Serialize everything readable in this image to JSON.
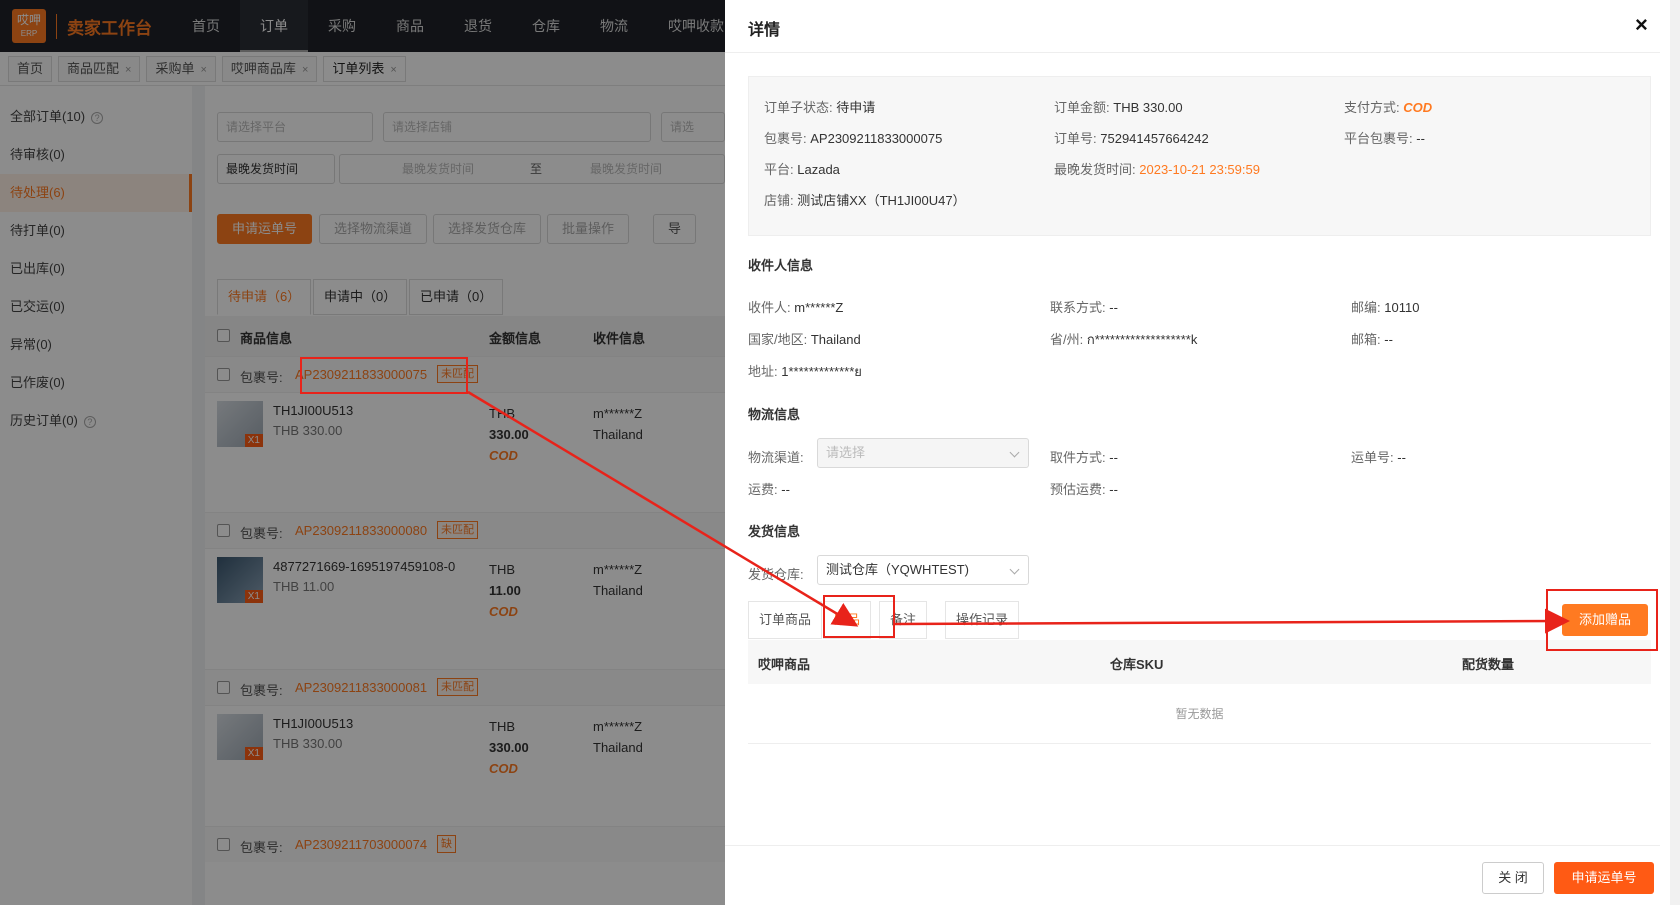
{
  "app": {
    "logo_top": "哎呷",
    "logo_bottom": "ERP",
    "brand": "卖家工作台"
  },
  "topnav": [
    "首页",
    "订单",
    "采购",
    "商品",
    "退货",
    "仓库",
    "物流",
    "哎呷收款"
  ],
  "page_tabs": [
    {
      "label": "首页"
    },
    {
      "label": "商品匹配"
    },
    {
      "label": "采购单"
    },
    {
      "label": "哎呷商品库"
    },
    {
      "label": "订单列表"
    }
  ],
  "sidebar": [
    {
      "label": "全部订单(10)"
    },
    {
      "label": "待审核(0)"
    },
    {
      "label": "待处理(6)"
    },
    {
      "label": "待打单(0)"
    },
    {
      "label": "已出库(0)"
    },
    {
      "label": "已交运(0)"
    },
    {
      "label": "异常(0)"
    },
    {
      "label": "已作废(0)"
    },
    {
      "label": "历史订单(0)"
    }
  ],
  "filters": {
    "platform_placeholder": "请选择平台",
    "shop_placeholder": "请选择店铺",
    "more_placeholder": "请选",
    "time_type": "最晚发货时间",
    "time_start": "最晚发货时间",
    "time_sep": "至",
    "time_end": "最晚发货时间"
  },
  "actions": [
    "申请运单号",
    "选择物流渠道",
    "选择发货仓库",
    "批量操作",
    "导"
  ],
  "status_tabs": [
    "待申请（6）",
    "申请中（0）",
    "已申请（0）"
  ],
  "table_head": {
    "product": "商品信息",
    "amount": "金额信息",
    "receiver": "收件信息"
  },
  "orders": [
    {
      "pkg_label": "包裹号:",
      "pkg_no": "AP2309211833000075",
      "badge": "未匹配",
      "title": "TH1JI00U513",
      "price": "THB 330.00",
      "qty": "X1",
      "cur": "THB",
      "amount": "330.00",
      "pay": "COD",
      "recv_name": "m******Z",
      "recv_country": "Thailand"
    },
    {
      "pkg_label": "包裹号:",
      "pkg_no": "AP2309211833000080",
      "badge": "未匹配",
      "title": "4877271669-1695197459108-0",
      "price": "THB 11.00",
      "qty": "X1",
      "cur": "THB",
      "amount": "11.00",
      "pay": "COD",
      "recv_name": "m******Z",
      "recv_country": "Thailand"
    },
    {
      "pkg_label": "包裹号:",
      "pkg_no": "AP2309211833000081",
      "badge": "未匹配",
      "title": "TH1JI00U513",
      "price": "THB 330.00",
      "qty": "X1",
      "cur": "THB",
      "amount": "330.00",
      "pay": "COD",
      "recv_name": "m******Z",
      "recv_country": "Thailand"
    },
    {
      "pkg_label": "包裹号:",
      "pkg_no": "AP2309211703000074",
      "badge": "缺"
    }
  ],
  "drawer": {
    "title": "详情",
    "close_icon": "×",
    "summary": {
      "sub_status_k": "订单子状态:",
      "sub_status_v": "待申请",
      "amount_k": "订单金额:",
      "amount_v": "THB 330.00",
      "pay_k": "支付方式:",
      "pay_v": "COD",
      "pkg_k": "包裹号:",
      "pkg_v": "AP2309211833000075",
      "order_k": "订单号:",
      "order_v": "752941457664242",
      "plat_pkg_k": "平台包裹号:",
      "plat_pkg_v": "--",
      "platform_k": "平台:",
      "platform_v": "Lazada",
      "deadline_k": "最晚发货时间:",
      "deadline_v": "2023-10-21 23:59:59",
      "shop_k": "店铺:",
      "shop_v": "测试店铺XX（TH1JI00U47）"
    },
    "receiver": {
      "title": "收件人信息",
      "name_k": "收件人:",
      "name_v": "m******Z",
      "contact_k": "联系方式:",
      "contact_v": "--",
      "zip_k": "邮编:",
      "zip_v": "10110",
      "country_k": "国家/地区:",
      "country_v": "Thailand",
      "province_k": "省/州:",
      "province_v": "ก*******************k",
      "email_k": "邮箱:",
      "email_v": "--",
      "address_k": "地址:",
      "address_v": "1*************ย"
    },
    "logistics": {
      "title": "物流信息",
      "channel_k": "物流渠道:",
      "channel_placeholder": "请选择",
      "pickup_k": "取件方式:",
      "pickup_v": "--",
      "waybill_k": "运单号:",
      "waybill_v": "--",
      "fee_k": "运费:",
      "fee_v": "--",
      "est_fee_k": "预估运费:",
      "est_fee_v": "--"
    },
    "shipping": {
      "title": "发货信息",
      "warehouse_k": "发货仓库:",
      "warehouse_v": "测试仓库（YQWHTEST)"
    },
    "tabs": [
      "订单商品",
      "赠品",
      "备注",
      "操作记录"
    ],
    "add_gift": "添加赠品",
    "gift_table": {
      "col1": "哎呷商品",
      "col2": "仓库SKU",
      "col3": "配货数量",
      "empty": "暂无数据"
    },
    "footer": {
      "close": "关 闭",
      "apply": "申请运单号"
    }
  },
  "colors": {
    "accent": "#ff7a21",
    "annotation": "#e8231a"
  }
}
